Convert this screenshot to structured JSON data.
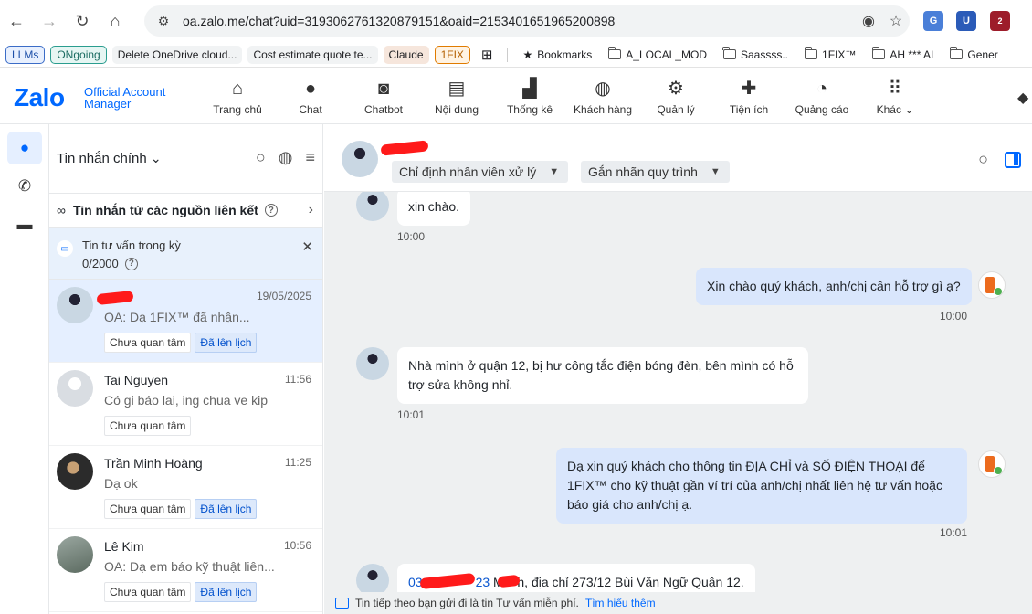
{
  "browser": {
    "url": "oa.zalo.me/chat?uid=3193062761320879151&oaid=2153401651965200898",
    "extension_badge": "2"
  },
  "bookmarks": {
    "chips": [
      "LLMs",
      "ONgoing",
      "Delete OneDrive cloud...",
      "Cost estimate quote te...",
      "Claude",
      "1FIX"
    ],
    "items": [
      "Bookmarks",
      "A_LOCAL_MOD",
      "Saassss..",
      "1FIX™",
      "AH *** AI",
      "Gener"
    ]
  },
  "zalo": {
    "logo": "Zalo",
    "subtitle_line1": "Official Account",
    "subtitle_line2": "Manager",
    "nav": [
      {
        "label": "Trang chủ",
        "icon": "home-icon"
      },
      {
        "label": "Chat",
        "icon": "chat-icon"
      },
      {
        "label": "Chatbot",
        "icon": "robot-icon"
      },
      {
        "label": "Nội dung",
        "icon": "document-icon"
      },
      {
        "label": "Thống kê",
        "icon": "chart-icon"
      },
      {
        "label": "Khách hàng",
        "icon": "users-icon"
      },
      {
        "label": "Quản lý",
        "icon": "gear-icon"
      },
      {
        "label": "Tiện ích",
        "icon": "puzzle-icon"
      },
      {
        "label": "Quảng cáo",
        "icon": "megaphone-icon"
      },
      {
        "label": "Khác",
        "icon": "grid-icon"
      }
    ]
  },
  "sidebar": {
    "title": "Tin nhắn chính",
    "linked_sources": "Tin nhắn từ các nguồn liên kết",
    "consult_label": "Tin tư vấn trong kỳ",
    "consult_count": "0/2000",
    "conversations": [
      {
        "name": "",
        "time": "19/05/2025",
        "snippet": "OA: Dạ 1FIX™ đã nhận...",
        "tags": [
          "Chưa quan tâm",
          "Đã lên lịch"
        ]
      },
      {
        "name": "Tai Nguyen",
        "time": "11:56",
        "snippet": "Có gi báo lai, ing chua ve kip",
        "tags": [
          "Chưa quan tâm"
        ]
      },
      {
        "name": "Trần Minh Hoàng",
        "time": "11:25",
        "snippet": "Dạ ok",
        "tags": [
          "Chưa quan tâm",
          "Đã lên lịch"
        ]
      },
      {
        "name": "Lê Kim",
        "time": "10:56",
        "snippet": "OA: Dạ em báo kỹ thuật liên...",
        "tags": [
          "Chưa quan tâm",
          "Đã lên lịch"
        ]
      }
    ]
  },
  "chat": {
    "assign_staff": "Chỉ định nhân viên xử lý",
    "assign_label": "Gắn nhãn quy trình",
    "messages": [
      {
        "dir": "in",
        "text": "xin chào.",
        "time": "10:00"
      },
      {
        "dir": "out",
        "text": "Xin chào quý khách, anh/chị cần hỗ trợ gì ạ?",
        "time": "10:00"
      },
      {
        "dir": "in",
        "text": "Nhà mình ở quận 12, bị hư công tắc điện bóng đèn, bên mình có hỗ trợ sửa không nhỉ.",
        "time": "10:01"
      },
      {
        "dir": "out",
        "text": "Dạ xin quý khách cho thông tin ĐỊA CHỈ và SỐ ĐIỆN THOẠI để 1FIX™ cho kỹ thuật gần ví trí của anh/chị nhất liên hệ tư vấn hoặc báo giá cho anh/chị ạ.",
        "time": "10:01"
      }
    ],
    "last_message": {
      "phone_prefix": "03",
      "phone_suffix": "23",
      "mid": " Mr",
      "rest": "h, địa chỉ 273/12 Bùi Văn Ngữ Quận 12."
    },
    "footer_text": "Tin tiếp theo bạn gửi đi là tin Tư vấn miễn phí.",
    "footer_link": "Tìm hiểu thêm"
  }
}
